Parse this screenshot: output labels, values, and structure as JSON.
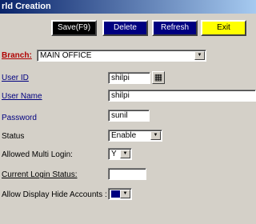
{
  "window": {
    "title": "rld Creation"
  },
  "toolbar": {
    "save_label": "Save(F9)",
    "delete_label": "Delete",
    "refresh_label": "Refresh",
    "exit_label": "Exit"
  },
  "form": {
    "branch": {
      "label": "Branch:",
      "value": "MAIN OFFICE"
    },
    "user_id": {
      "label": "User ID",
      "value": "shilpi",
      "picker_icon": "grid-icon"
    },
    "user_name": {
      "label": "User Name",
      "value": "shilpi"
    },
    "password": {
      "label": "Password",
      "value": "sunil"
    },
    "status": {
      "label": "Status",
      "value": "Enable"
    },
    "multi_login": {
      "label": "Allowed Multi Login:",
      "value": "Y"
    },
    "current_login_status": {
      "label": "Current Login Status:",
      "value": ""
    },
    "display_hide_accounts": {
      "label": "Allow Display Hide Accounts :",
      "value": ""
    }
  },
  "colors": {
    "accent": "#000080",
    "yellow": "#ffff00",
    "branch_label": "#b00000"
  }
}
